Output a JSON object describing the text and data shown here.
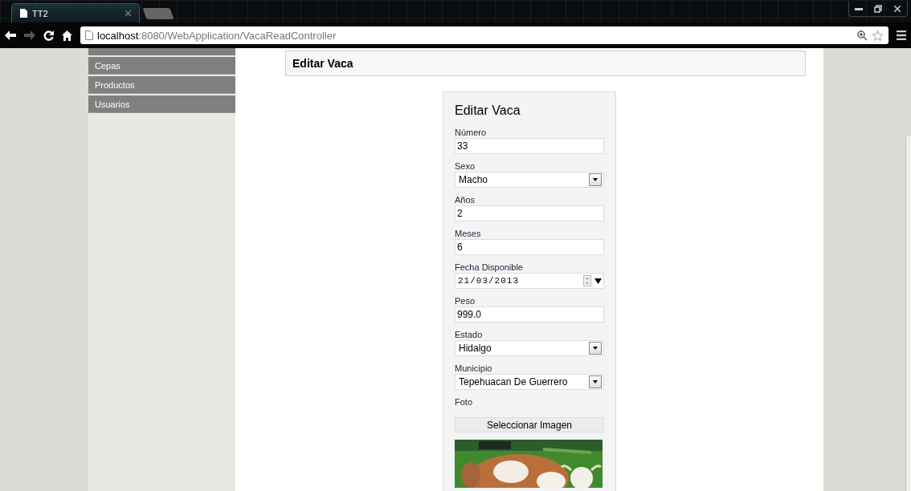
{
  "browser": {
    "tab_title": "TT2",
    "url_host": "localhost",
    "url_rest": ":8080/WebApplication/VacaReadController"
  },
  "sidebar": {
    "items": [
      {
        "label": "Cepas",
        "selected": false
      },
      {
        "label": "Productos",
        "selected": false
      },
      {
        "label": "Usuarios",
        "selected": false
      }
    ]
  },
  "header": {
    "title": "Editar Vaca"
  },
  "form": {
    "title": "Editar Vaca",
    "fields": [
      {
        "kind": "text",
        "label": "Número",
        "value": "33"
      },
      {
        "kind": "select",
        "label": "Sexo",
        "value": "Macho"
      },
      {
        "kind": "text",
        "label": "Años",
        "value": "2"
      },
      {
        "kind": "text",
        "label": "Meses",
        "value": "6"
      },
      {
        "kind": "date",
        "label": "Fecha Disponible",
        "value": "21/03/2013"
      },
      {
        "kind": "text",
        "label": "Peso",
        "value": "999.0"
      },
      {
        "kind": "select",
        "label": "Estado",
        "value": "Hidalgo"
      },
      {
        "kind": "select",
        "label": "Municipio",
        "value": "Tepehuacan De Guerrero"
      },
      {
        "kind": "file",
        "label": "Foto",
        "button": "Seleccionar Imagen"
      }
    ]
  }
}
